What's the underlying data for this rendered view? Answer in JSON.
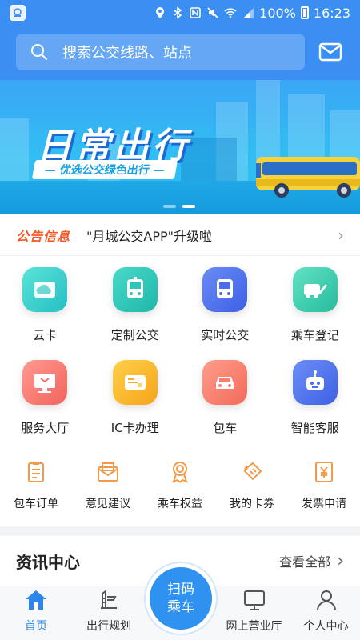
{
  "status_bar": {
    "battery": "100%",
    "time": "16:23"
  },
  "search": {
    "placeholder": "搜索公交线路、站点"
  },
  "banner": {
    "title": "日常出行",
    "subtitle": "— 优选公交绿色出行 —",
    "active_slide": 2,
    "slide_count": 2
  },
  "notice": {
    "tag": "公告信息",
    "text": "\"月城公交APP\"升级啦"
  },
  "main_grid": {
    "row1": [
      "云卡",
      "定制公交",
      "实时公交",
      "乘车登记"
    ],
    "row2": [
      "服务大厅",
      "IC卡办理",
      "包车",
      "智能客服"
    ]
  },
  "small_grid": [
    "包车订单",
    "意见建议",
    "乘车权益",
    "我的卡券",
    "发票申请"
  ],
  "news": {
    "title": "资讯中心",
    "more": "查看全部"
  },
  "tabbar": {
    "home": "首页",
    "route": "出行规划",
    "scan_line1": "扫码",
    "scan_line2": "乘车",
    "online": "网上营业厅",
    "me": "个人中心"
  },
  "colors": {
    "primary": "#3b8ff2",
    "notice_tag": "#f25b2a",
    "tab_active": "#2e86ea"
  }
}
